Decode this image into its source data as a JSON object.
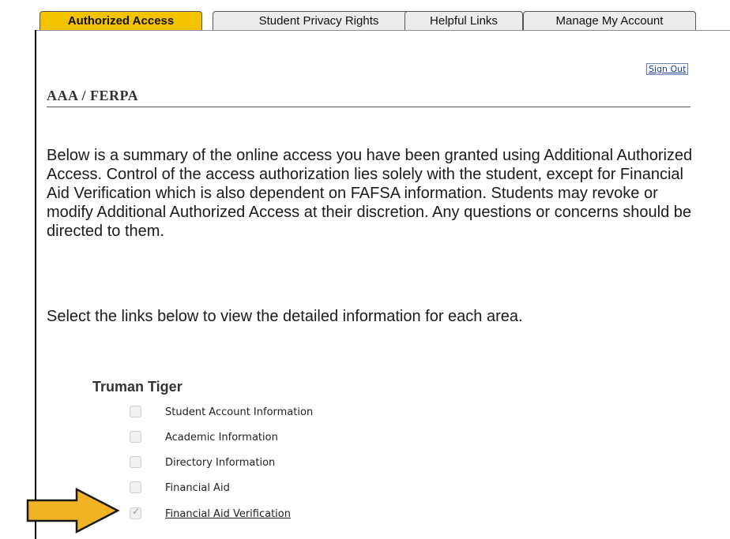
{
  "tabs": [
    {
      "label": "Authorized Access",
      "active": true
    },
    {
      "label": "Student Privacy Rights",
      "active": false
    },
    {
      "label": "Helpful Links",
      "active": false
    },
    {
      "label": "Manage My Account",
      "active": false
    }
  ],
  "header": {
    "sign_out_label": "Sign Out",
    "page_title": "AAA / FERPA"
  },
  "body": {
    "summary": "Below is a summary of the online access you have been granted using Additional Authorized Access. Control of the access authorization lies solely with the student, except for Financial Aid Verification which is also dependent on FAFSA information. Students may revoke or modify Additional Authorized Access at their discretion. Any questions or concerns should be directed to them.",
    "instructions": "Select the links below to view the detailed information for each area."
  },
  "student": {
    "name": "Truman Tiger",
    "access_items": [
      {
        "label": "Student Account Information",
        "checked": false,
        "is_link": false
      },
      {
        "label": "Academic Information",
        "checked": false,
        "is_link": false
      },
      {
        "label": "Directory Information",
        "checked": false,
        "is_link": false
      },
      {
        "label": "Financial Aid",
        "checked": false,
        "is_link": false
      },
      {
        "label": "Financial Aid Verification",
        "checked": true,
        "is_link": true
      }
    ]
  },
  "colors": {
    "active_tab": "#f3c300",
    "inactive_tab": "#ececec",
    "arrow_fill": "#f0b323",
    "link": "#1f3f8f"
  },
  "icons": {
    "pointer_arrow": "right-arrow-icon",
    "checkbox_check": "check-icon"
  }
}
